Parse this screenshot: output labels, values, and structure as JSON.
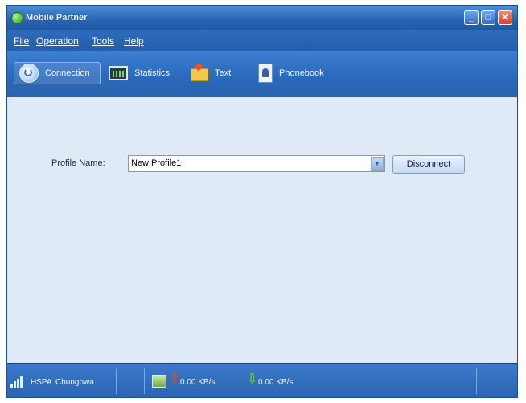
{
  "window": {
    "title": "Mobile Partner"
  },
  "menu": {
    "items": [
      "File",
      "Operation",
      "Tools",
      "Help"
    ]
  },
  "toolbar": {
    "items": [
      {
        "label": "Connection",
        "icon": "connection-icon"
      },
      {
        "label": "Statistics",
        "icon": "statistics-icon"
      },
      {
        "label": "Text",
        "icon": "text-message-icon"
      },
      {
        "label": "Phonebook",
        "icon": "phonebook-icon"
      }
    ]
  },
  "profile": {
    "label": "Profile Name:",
    "value": "New Profile1",
    "action_button": "Disconnect"
  },
  "status": {
    "network_type": "HSPA",
    "operator": "Chunghwa",
    "upload_rate": "0.00 KB/s",
    "download_rate": "0.00 KB/s"
  }
}
